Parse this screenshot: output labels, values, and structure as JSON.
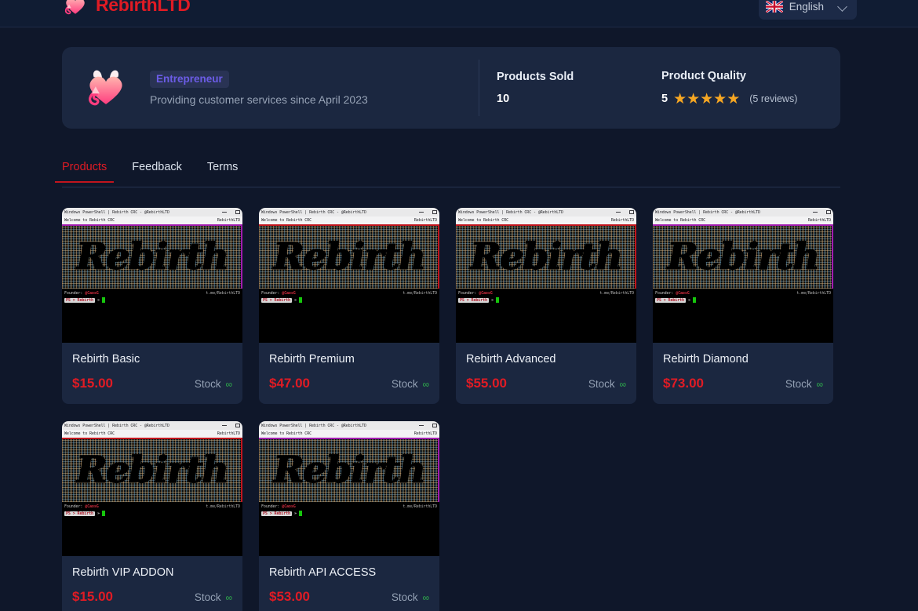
{
  "header": {
    "brand_name": "RebirthLTD",
    "brand_logo_icon": "devil-heart-icon",
    "language": {
      "flag_icon": "uk-flag-icon",
      "label": "English",
      "chevron_icon": "chevron-down-icon"
    }
  },
  "profile": {
    "avatar_icon": "devil-heart-avatar-icon",
    "role_badge": "Entrepreneur",
    "tagline": "Providing customer services since April 2023",
    "stats": [
      {
        "label": "Products Sold",
        "value": "10"
      }
    ],
    "rating": {
      "label": "Product Quality",
      "value": "5",
      "stars": "★★★★★",
      "star_count": 5,
      "reviews": "(5 reviews)"
    }
  },
  "tabs": [
    {
      "label": "Products",
      "active": true
    },
    {
      "label": "Feedback",
      "active": false
    },
    {
      "label": "Terms",
      "active": false
    }
  ],
  "thumbnail": {
    "window_title": "Windows PowerShell | Rebirth CRC - @RebirthLTD",
    "tab_label": "Welcome to Rebirth CRC",
    "tab_right_label": "RebirthLTD",
    "ascii_word": "Rebirth",
    "founder_prefix": "Founder: ",
    "founder_name": "@CaosG",
    "link": "t.me/RebirthLTD",
    "prompt_chip": "PS > Rebirth",
    "prompt_arrow": "»"
  },
  "products": [
    {
      "title": "Rebirth Basic",
      "price": "$15.00",
      "stock_label": "Stock",
      "stock_value": "∞",
      "accent": "#a21caf"
    },
    {
      "title": "Rebirth Premium",
      "price": "$47.00",
      "stock_label": "Stock",
      "stock_value": "∞",
      "accent": "#c2151d"
    },
    {
      "title": "Rebirth Advanced",
      "price": "$55.00",
      "stock_label": "Stock",
      "stock_value": "∞",
      "accent": "#c2151d"
    },
    {
      "title": "Rebirth Diamond",
      "price": "$73.00",
      "stock_label": "Stock",
      "stock_value": "∞",
      "accent": "#a21caf"
    },
    {
      "title": "Rebirth VIP ADDON",
      "price": "$15.00",
      "stock_label": "Stock",
      "stock_value": "∞",
      "accent": "#c2151d"
    },
    {
      "title": "Rebirth API ACCESS",
      "price": "$53.00",
      "stock_label": "Stock",
      "stock_value": "∞",
      "accent": "#a21caf"
    }
  ],
  "colors": {
    "page_bg": "#0f172a",
    "panel_bg": "#1b2740",
    "brand_red": "#e01b24",
    "price_red": "#e01b24",
    "badge_purple": "#6c5ce7",
    "star_gold": "#f5a623",
    "stock_green": "#2fb24c"
  }
}
